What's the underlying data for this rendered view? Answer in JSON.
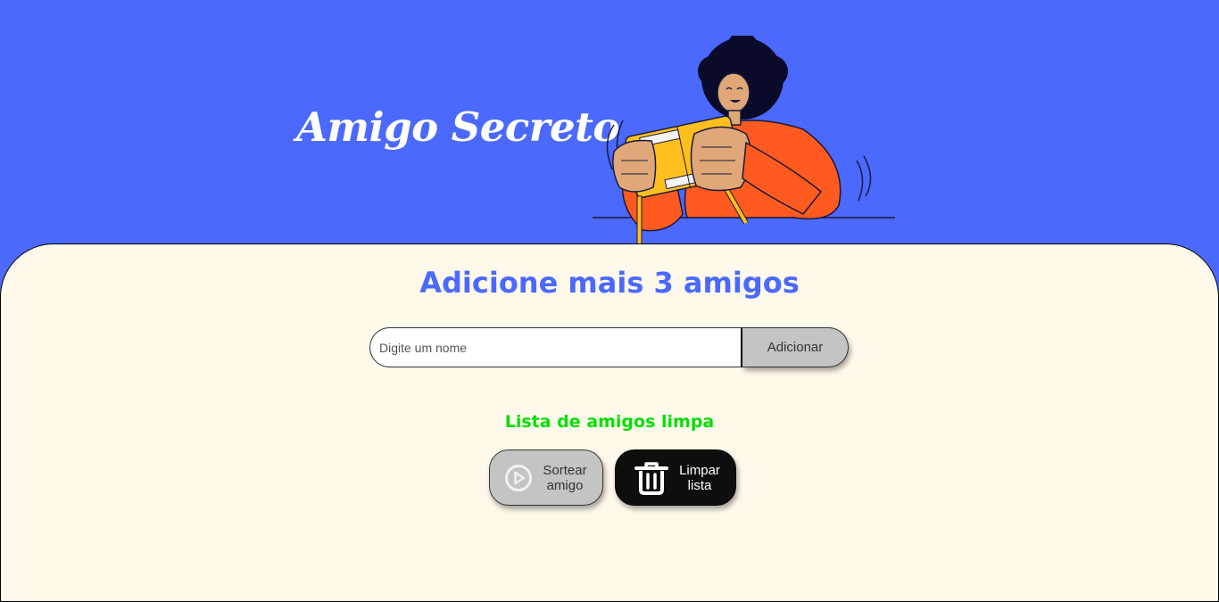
{
  "header": {
    "title": "Amigo Secreto"
  },
  "main": {
    "subtitle": "Adicione mais 3 amigos",
    "name_input": {
      "placeholder": "Digite um nome",
      "value": ""
    },
    "add_button_label": "Adicionar",
    "status_message": "Lista de amigos limpa",
    "draw_button": {
      "line1": "Sortear",
      "line2": "amigo",
      "icon": "play-circle-icon"
    },
    "clear_button": {
      "line1": "Limpar",
      "line2": "lista",
      "icon": "trash-icon"
    }
  },
  "colors": {
    "header_background": "#4b69fd",
    "main_background": "#fff9eb",
    "subtitle": "#4b69fd",
    "status_success": "#05df05",
    "button_gray": "#c4c4c4",
    "button_dark": "#0e0e0e"
  }
}
